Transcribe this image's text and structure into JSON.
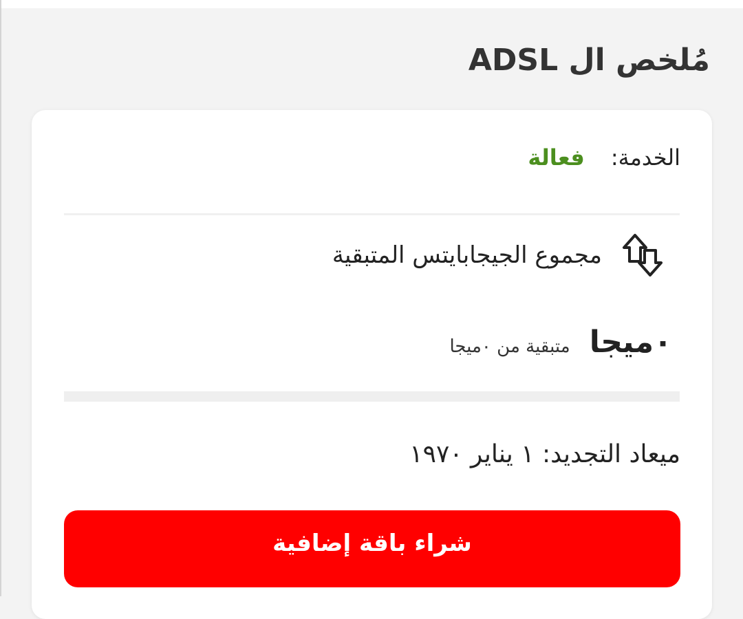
{
  "page": {
    "title": "مُلخص ال ADSL"
  },
  "service": {
    "label": "الخدمة:",
    "status": "فعالة",
    "status_color": "#4c8f1f"
  },
  "gigabytes": {
    "icon": "transfer-arrows-icon",
    "label": "مجموع الجيجابايتس المتبقية"
  },
  "usage": {
    "remaining": "٠ميجا",
    "total": "متبقية من ٠ميجا"
  },
  "renewal": {
    "text": "ميعاد التجديد: ١ يناير ١٩٧٠"
  },
  "actions": {
    "buy_label": "شراء باقة إضافية",
    "buy_color": "#ff0000"
  }
}
